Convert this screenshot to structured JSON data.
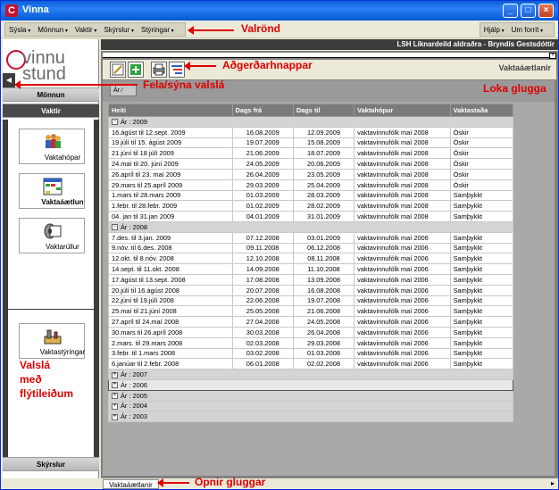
{
  "window": {
    "title": "Vinna",
    "app_icon": "C"
  },
  "menu": {
    "left": [
      "Sýsla",
      "Mönnun",
      "Vaktir",
      "Skýrslur",
      "Stýringar"
    ],
    "right": [
      "Hjálp",
      "Um forrit"
    ]
  },
  "header": {
    "org_user": "LSH Líknardeild aldraðra - Bryndís Gestsdóttir"
  },
  "logo": {
    "line1": "vinnu",
    "line2": "stund"
  },
  "sidebar": {
    "monnun": "Mönnun",
    "vaktir": "Vaktir",
    "skyrslur": "Skýrslur",
    "items": [
      {
        "label": "Vaktahópar",
        "icon": "people-group-icon",
        "selected": false
      },
      {
        "label": "Vaktaáætlun",
        "icon": "schedule-grid-icon",
        "selected": true
      },
      {
        "label": "Vaktarúllur",
        "icon": "roll-icon",
        "selected": false
      },
      {
        "label": "Vaktastýringar",
        "icon": "tools-icon",
        "selected": false
      }
    ]
  },
  "window_panel": {
    "title": "Vaktaáætlanir",
    "group_chip": "Ár"
  },
  "grid": {
    "columns": [
      "Heiti",
      "Dags frá",
      "Dags til",
      "Vaktahópur",
      "Vaktastaða"
    ],
    "groups": [
      {
        "label": "Ár : 2009",
        "expanded": true,
        "selected": false,
        "rows": [
          [
            "16.ágúst til 12.sept. 2009",
            "16.08.2009",
            "12.09.2009",
            "vaktavinnufólk maí 2008",
            "Óskir"
          ],
          [
            "19.júlí til 15. ágúst 2009",
            "19.07.2009",
            "15.08.2009",
            "vaktavinnufólk maí 2008",
            "Óskir"
          ],
          [
            "21.júní til 18 júlí 2009",
            "21.06.2009",
            "18.07.2009",
            "vaktavinnufólk maí 2008",
            "Óskir"
          ],
          [
            "24.maí til 20. júní 2009",
            "24.05.2009",
            "20.06.2009",
            "vaktavinnufólk maí 2008",
            "Óskir"
          ],
          [
            "26.apríl til 23. maí 2009",
            "26.04.2009",
            "23.05.2009",
            "vaktavinnufólk maí 2008",
            "Óskir"
          ],
          [
            "29.mars til 25.apríl 2009",
            "29.03.2009",
            "25.04.2009",
            "vaktavinnufólk maí 2008",
            "Óskir"
          ],
          [
            "1.mars til 28.mars 2009",
            "01.03.2009",
            "28.03.2009",
            "vaktavinnufólk maí 2008",
            "Samþykkt"
          ],
          [
            "1.febr. til 28.febr. 2009",
            "01.02.2009",
            "28.02.2009",
            "vaktavinnufólk maí 2008",
            "Samþykkt"
          ],
          [
            "04. jan til 31.jan 2009",
            "04.01.2009",
            "31.01.2009",
            "vaktavinnufólk maí 2008",
            "Samþykkt"
          ]
        ]
      },
      {
        "label": "Ár : 2008",
        "expanded": true,
        "selected": false,
        "rows": [
          [
            "7.des. til 3.jan. 2009",
            "07.12.2008",
            "03.01.2009",
            "vaktavinnufólk maí 2006",
            "Samþykkt"
          ],
          [
            "9.nóv. til 6.des. 2008",
            "09.11.2008",
            "06.12.2008",
            "vaktavinnufólk maí 2006",
            "Samþykkt"
          ],
          [
            "12.okt. til 8.nóv. 2008",
            "12.10.2008",
            "08.11.2008",
            "vaktavinnufólk maí 2006",
            "Samþykkt"
          ],
          [
            "14.sept. til 11.okt. 2008",
            "14.09.2008",
            "11.10.2008",
            "vaktavinnufólk maí 2006",
            "Samþykkt"
          ],
          [
            "17.ágúst til 13.sept. 2008",
            "17.08.2008",
            "13.09.2008",
            "vaktavinnufólk maí 2006",
            "Samþykkt"
          ],
          [
            "20.júlí til 16.ágúst 2008",
            "20.07.2008",
            "16.08.2008",
            "vaktavinnufólk maí 2006",
            "Samþykkt"
          ],
          [
            "22.júní til 19.júlí 2008",
            "22.06.2008",
            "19.07.2008",
            "vaktavinnufólk maí 2006",
            "Samþykkt"
          ],
          [
            "25.maí til 21.júní 2008",
            "25.05.2008",
            "21.06.2008",
            "vaktavinnufólk maí 2006",
            "Samþykkt"
          ],
          [
            "27.apríl til 24.maí 2008",
            "27.04.2008",
            "24.05.2008",
            "vaktavinnufólk maí 2006",
            "Samþykkt"
          ],
          [
            "30.mars til 26.apríl 2008",
            "30.03.2008",
            "26.04.2008",
            "vaktavinnufólk maí 2006",
            "Samþykkt"
          ],
          [
            "2.mars. til 29.mars 2008",
            "02.03.2008",
            "29.03.2008",
            "vaktavinnufólk maí 2006",
            "Samþykkt"
          ],
          [
            "3.febr. til 1.mars 2008",
            "03.02.2008",
            "01.03.2008",
            "vaktavinnufólk maí 2006",
            "Samþykkt"
          ],
          [
            "6.janúar til 2.febr. 2008",
            "06.01.2008",
            "02.02.2008",
            "vaktavinnufólk maí 2006",
            "Samþykkt"
          ]
        ]
      },
      {
        "label": "Ár : 2007",
        "expanded": false,
        "selected": false,
        "rows": []
      },
      {
        "label": "Ár : 2006",
        "expanded": false,
        "selected": true,
        "rows": []
      },
      {
        "label": "Ár : 2005",
        "expanded": false,
        "selected": false,
        "rows": []
      },
      {
        "label": "Ár : 2004",
        "expanded": false,
        "selected": false,
        "rows": []
      },
      {
        "label": "Ár : 2003",
        "expanded": false,
        "selected": false,
        "rows": []
      }
    ]
  },
  "statusbar": {
    "open_window": "Vaktaáætlanir",
    "scroll_glyph": "▸"
  },
  "annotations": {
    "menu": "Valrönd",
    "toolbar": "Aðgerðarhnappar",
    "toggle": "Fela/sýna valslá",
    "close_window": "Loka glugga",
    "sidebar_line1": "Valslá",
    "sidebar_line2": "með",
    "sidebar_line3": "flýtileiðum",
    "open_windows": "Opnir gluggar"
  },
  "colors": {
    "annotation": "#e00000",
    "titlebar": "#0a5fd8"
  }
}
